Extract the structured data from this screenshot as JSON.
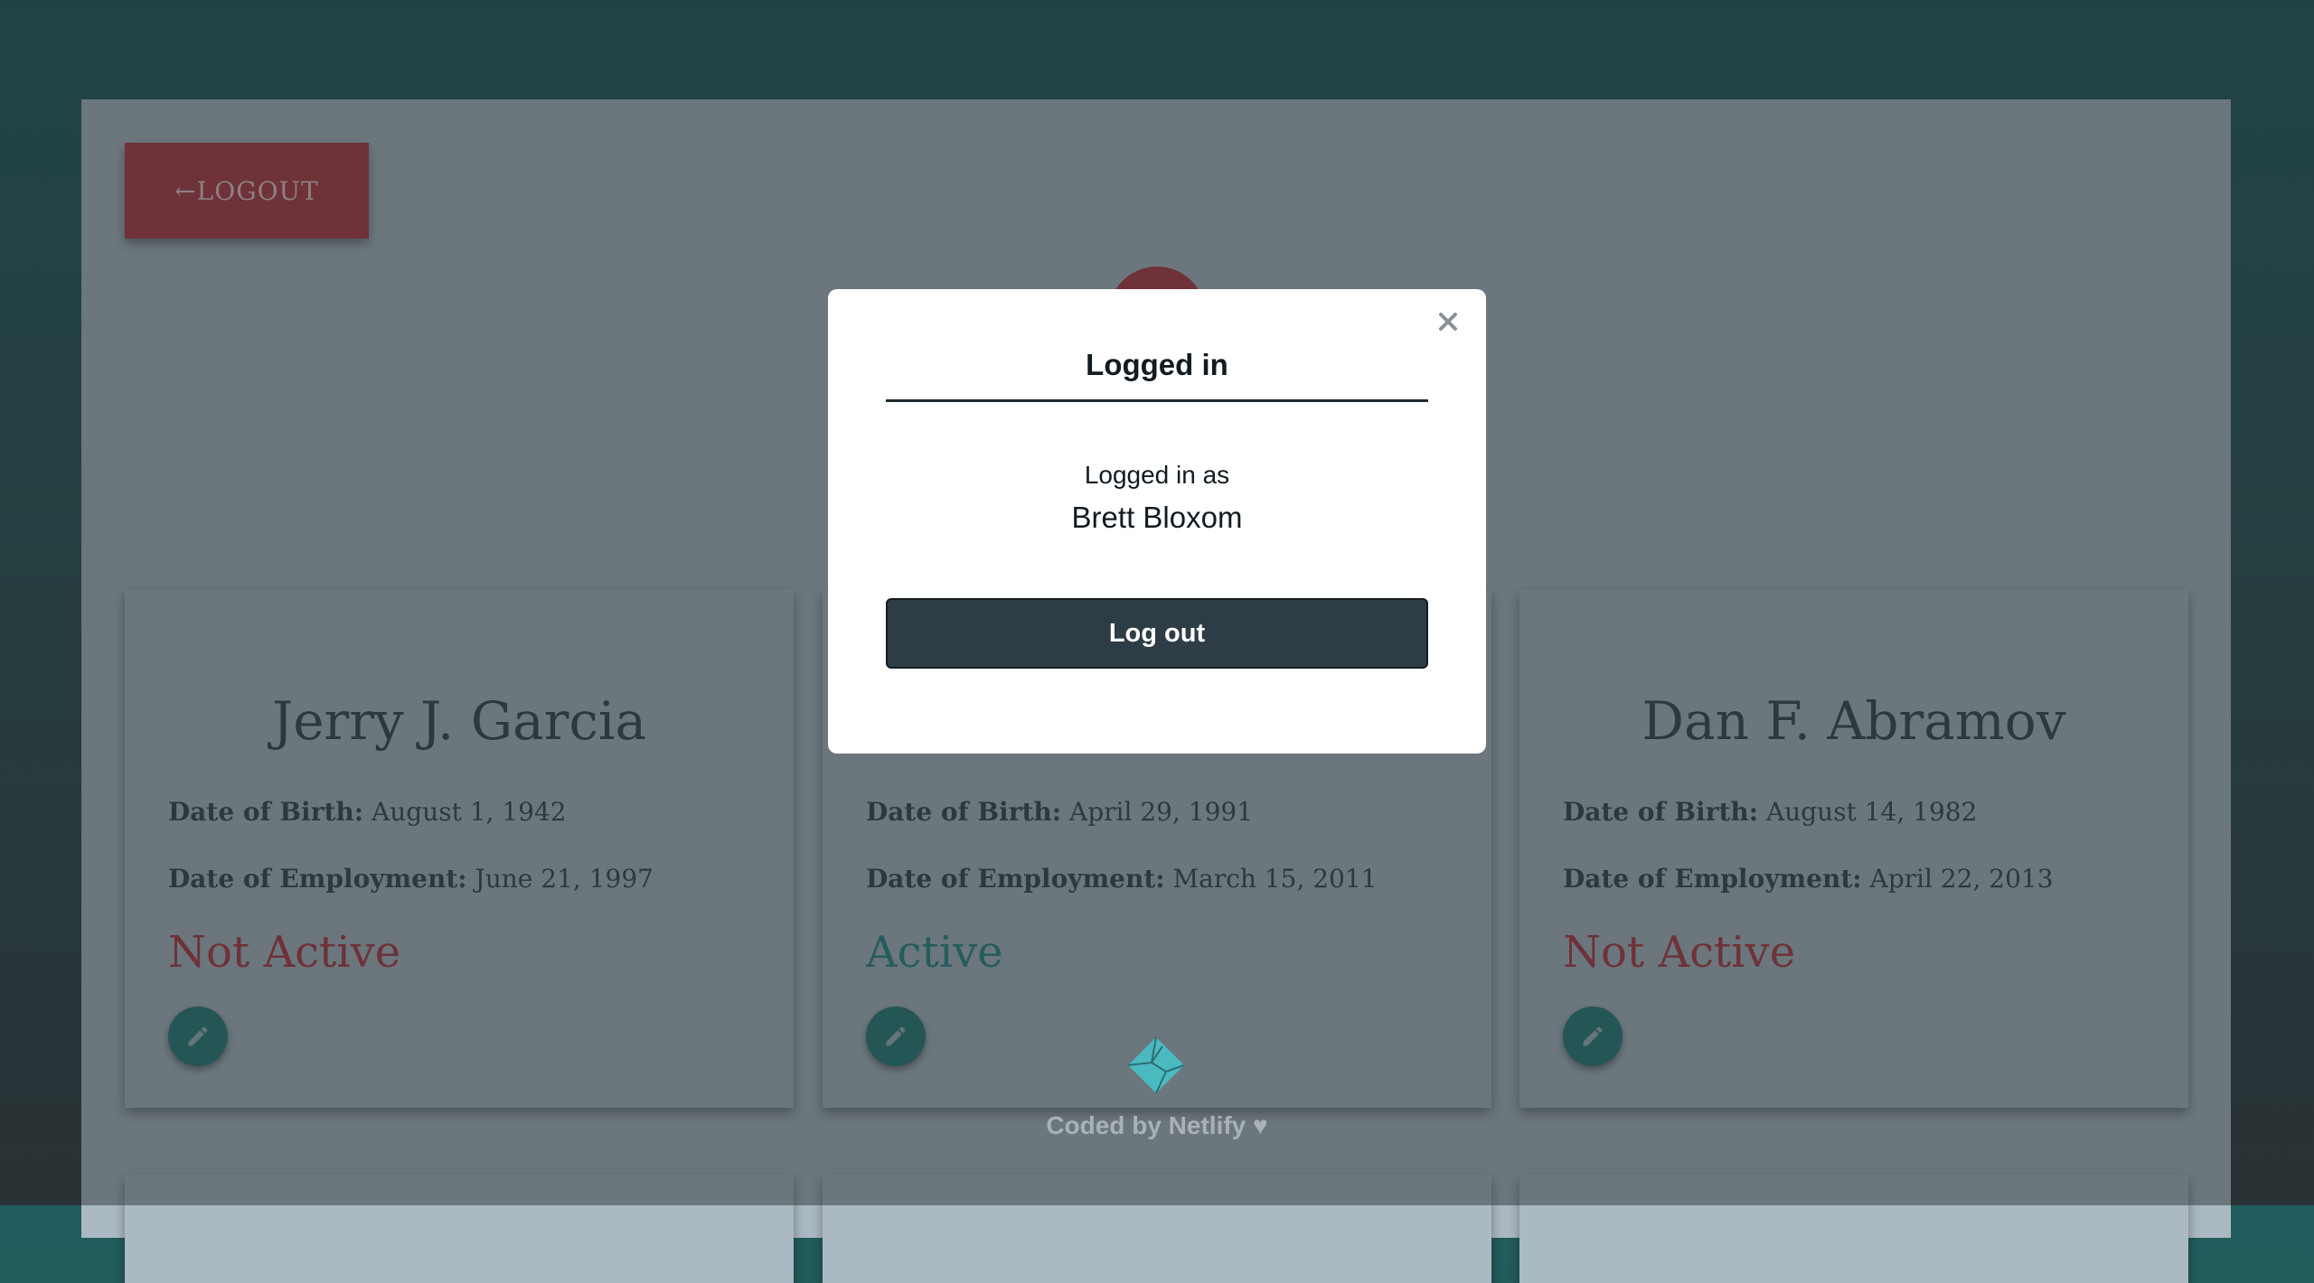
{
  "header": {
    "logout_label": "←LOGOUT"
  },
  "employees": [
    {
      "name": "Jerry J. Garcia",
      "dob_label": "Date of Birth:",
      "dob": "August 1, 1942",
      "doe_label": "Date of Employment:",
      "doe": "June 21, 1997",
      "status": "Not Active"
    },
    {
      "name": "",
      "dob_label": "Date of Birth:",
      "dob": "April 29, 1991",
      "doe_label": "Date of Employment:",
      "doe": "March 15, 2011",
      "status": "Active"
    },
    {
      "name": "Dan F. Abramov",
      "dob_label": "Date of Birth:",
      "dob": "August 14, 1982",
      "doe_label": "Date of Employment:",
      "doe": "April 22, 2013",
      "status": "Not Active"
    }
  ],
  "modal": {
    "title": "Logged in",
    "subtitle": "Logged in as",
    "user": "Brett Bloxom",
    "button_label": "Log out",
    "close_icon": "close-icon"
  },
  "footer": {
    "text": "Coded by Netlify ♥",
    "logo_icon": "netlify-logo-icon"
  },
  "colors": {
    "accent_red": "#b03d44",
    "accent_teal": "#2b7e7b",
    "modal_button": "#2e3d45"
  }
}
